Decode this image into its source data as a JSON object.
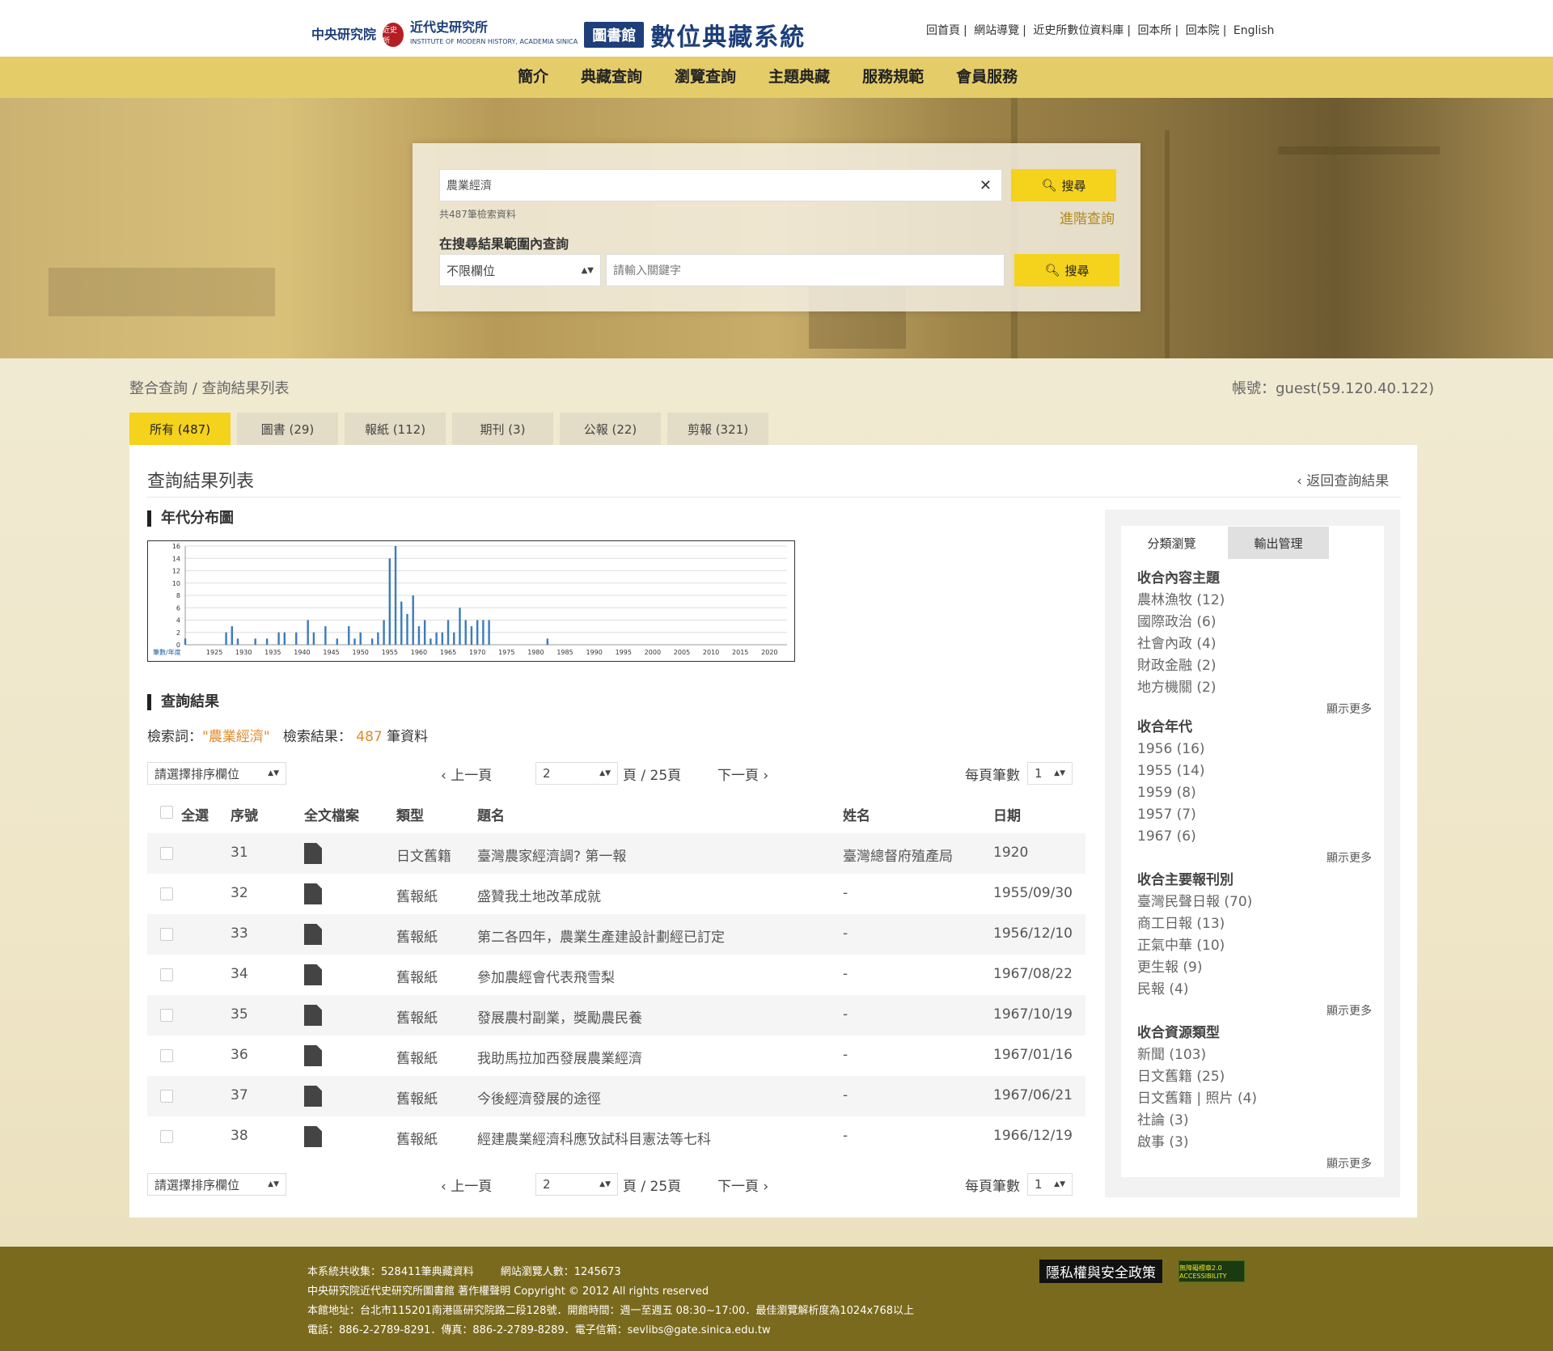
{
  "header": {
    "logo_ims": "中央研究院",
    "logo_seal": "近史所",
    "logo_inst": "近代史研究所",
    "logo_inst_en": "INSTITUTE OF MODERN HISTORY, ACADEMIA SINICA",
    "logo_lib": "圖書館",
    "logo_sys": "數位典藏系統",
    "links": [
      "回首頁",
      "網站導覽",
      "近史所數位資料庫",
      "回本所",
      "回本院",
      "English"
    ]
  },
  "nav": [
    "簡介",
    "典藏查詢",
    "瀏覽查詢",
    "主題典藏",
    "服務規範",
    "會員服務"
  ],
  "search": {
    "query": "農業經濟",
    "count_text": "共487筆檢索資料",
    "search_label": "搜尋",
    "advanced_label": "進階查詢",
    "within_label": "在搜尋結果範圍內查詢",
    "field_select": "不限欄位",
    "keyword_placeholder": "請輸入關鍵字"
  },
  "breadcrumb": "整合查詢 / 查詢結果列表",
  "account": "帳號：guest(59.120.40.122)",
  "tabs": [
    "所有 (487)",
    "圖書 (29)",
    "報紙 (112)",
    "期刊 (3)",
    "公報 (22)",
    "剪報 (321)"
  ],
  "main": {
    "title": "查詢結果列表",
    "back_label": "返回查詢結果",
    "chart_section": "年代分布圖",
    "results_section": "查詢結果",
    "query_label": "檢索詞：",
    "query_term": "\"農業經濟\"",
    "result_label": "檢索結果：",
    "result_count": "487",
    "result_unit": "筆資料"
  },
  "pagination": {
    "sort_placeholder": "請選擇排序欄位",
    "prev": "上一頁",
    "page": "2",
    "total": "頁 / 25頁",
    "next": "下一頁",
    "per_page_label": "每頁筆數",
    "per_page": "1"
  },
  "table": {
    "headers": [
      "全選",
      "序號",
      "全文檔案",
      "類型",
      "題名",
      "姓名",
      "日期"
    ],
    "rows": [
      {
        "no": "31",
        "type": "日文舊籍",
        "title": "臺灣農家經濟調? 第一報",
        "name": "臺灣總督府殖產局",
        "date": "1920"
      },
      {
        "no": "32",
        "type": "舊報紙",
        "title": "盛贊我土地改革成就",
        "name": "-",
        "date": "1955/09/30"
      },
      {
        "no": "33",
        "type": "舊報紙",
        "title": "第二各四年，農業生產建設計劃經已訂定",
        "name": "-",
        "date": "1956/12/10"
      },
      {
        "no": "34",
        "type": "舊報紙",
        "title": "參加農經會代表飛雪梨",
        "name": "-",
        "date": "1967/08/22"
      },
      {
        "no": "35",
        "type": "舊報紙",
        "title": "發展農村副業，獎勵農民養",
        "name": "-",
        "date": "1967/10/19"
      },
      {
        "no": "36",
        "type": "舊報紙",
        "title": "我助馬拉加西發展農業經濟",
        "name": "-",
        "date": "1967/01/16"
      },
      {
        "no": "37",
        "type": "舊報紙",
        "title": "今後經濟發展的途徑",
        "name": "-",
        "date": "1967/06/21"
      },
      {
        "no": "38",
        "type": "舊報紙",
        "title": "經建農業經濟科應攷試科目憲法等七科",
        "name": "-",
        "date": "1966/12/19"
      }
    ]
  },
  "sidebar": {
    "tabs": [
      "分類瀏覽",
      "輸出管理"
    ],
    "more_label": "顯示更多",
    "groups": [
      {
        "title": "收合內容主題",
        "items": [
          "農林漁牧 (12)",
          "國際政治 (6)",
          "社會內政 (4)",
          "財政金融 (2)",
          "地方機關 (2)"
        ]
      },
      {
        "title": "收合年代",
        "items": [
          "1956 (16)",
          "1955 (14)",
          "1959 (8)",
          "1957 (7)",
          "1967 (6)"
        ]
      },
      {
        "title": "收合主要報刊別",
        "items": [
          "臺灣民聲日報 (70)",
          "商工日報 (13)",
          "正氣中華 (10)",
          "更生報 (9)",
          "民報 (4)"
        ]
      },
      {
        "title": "收合資源類型",
        "items": [
          "新聞 (103)",
          "日文舊籍 (25)",
          "日文舊籍 | 照片 (4)",
          "社論 (3)",
          "啟事 (3)"
        ]
      }
    ]
  },
  "chart_data": {
    "type": "bar",
    "xlabel": "筆數/年度",
    "ylim": [
      0,
      16
    ],
    "yticks": [
      0,
      2,
      4,
      6,
      8,
      10,
      12,
      14,
      16
    ],
    "xlim": [
      1920,
      2023
    ],
    "xticks": [
      1925,
      1930,
      1935,
      1940,
      1945,
      1950,
      1955,
      1960,
      1965,
      1970,
      1975,
      1980,
      1985,
      1990,
      1995,
      2000,
      2005,
      2010,
      2015,
      2020
    ],
    "x": [
      1920,
      1927,
      1928,
      1929,
      1932,
      1934,
      1936,
      1937,
      1939,
      1941,
      1942,
      1944,
      1946,
      1948,
      1949,
      1950,
      1952,
      1953,
      1954,
      1955,
      1956,
      1957,
      1958,
      1959,
      1960,
      1961,
      1962,
      1963,
      1964,
      1965,
      1966,
      1967,
      1968,
      1969,
      1970,
      1971,
      1972,
      1982
    ],
    "values": [
      1,
      2,
      3,
      1,
      1,
      1,
      2,
      2,
      2,
      4,
      2,
      3,
      1,
      3,
      1,
      2,
      1,
      2,
      4,
      14,
      16,
      7,
      5,
      8,
      3,
      4,
      1,
      2,
      2,
      4,
      2,
      6,
      4,
      3,
      4,
      4,
      4,
      1
    ],
    "color": "#3b7bbf"
  },
  "footer": {
    "line1a": "本系統共收集：528411筆典藏資料",
    "line1b": "網站瀏覽人數：1245673",
    "line2": "中央研究院近代史研究所圖書館 著作權聲明 Copyright © 2012 All rights reserved",
    "line3": "本館地址：台北市115201南港區研究院路二段128號．開館時間：週一至週五 08:30~17:00．最佳瀏覽解析度為1024x768以上",
    "line4": "電話：886-2-2789-8291．傳真：886-2-2789-8289．電子信箱：sevlibs@gate.sinica.edu.tw",
    "privacy": "隱私權與安全政策",
    "a11y": "無障礙標章2.0 ACCESSIBILITY"
  }
}
